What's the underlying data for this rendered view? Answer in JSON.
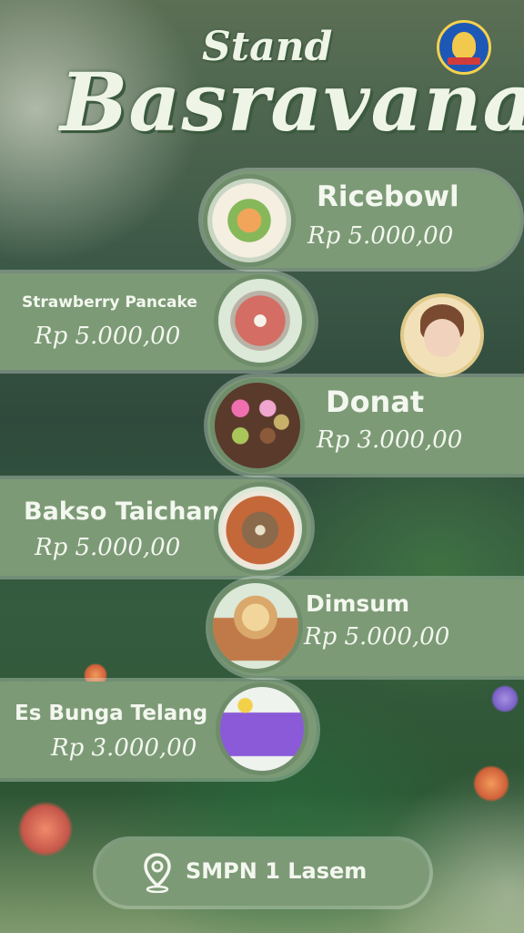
{
  "header": {
    "subtitle": "Stand",
    "title": "Basravana",
    "logo": "school-emblem"
  },
  "menu": [
    {
      "name": "Ricebowl",
      "price": "Rp 5.000,00",
      "image": "ricebowl-dish"
    },
    {
      "name": "Strawberry Pancake",
      "price": "Rp 5.000,00",
      "image": "strawberry-pancake-dish"
    },
    {
      "name": "Donat",
      "price": "Rp 3.000,00",
      "image": "donut-box"
    },
    {
      "name": "Bakso Taichan",
      "price": "Rp 5.000,00",
      "image": "bakso-bowl"
    },
    {
      "name": "Dimsum",
      "price": "Rp 5.000,00",
      "image": "dimsum-steamer"
    },
    {
      "name": "Es Bunga Telang",
      "price": "Rp 3.000,00",
      "image": "butterfly-pea-drink"
    }
  ],
  "location": {
    "icon": "location-pin-icon",
    "label": "SMPN 1 Lasem"
  },
  "colors": {
    "card": "#7c9a76",
    "text": "#f3f7ef",
    "forest": "#2f4a3c"
  }
}
